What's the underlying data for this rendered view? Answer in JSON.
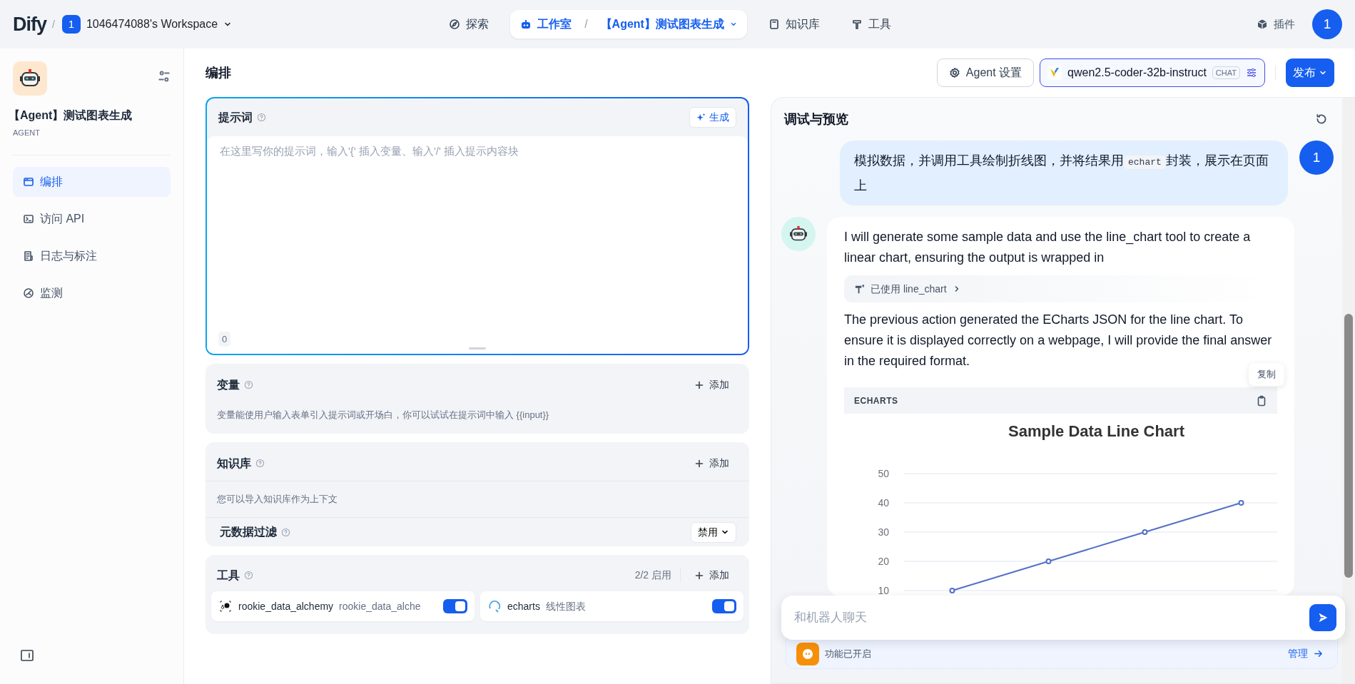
{
  "topbar": {
    "logo": "Dify",
    "separator": "/",
    "workspace": {
      "badge": "1",
      "name": "1046474088's Workspace"
    },
    "nav": [
      {
        "label": "探索",
        "kind": "explore",
        "selected": false
      },
      {
        "label": "工作室",
        "kind": "studio",
        "selected": true,
        "separator": "/",
        "app_name": "【Agent】测试图表生成"
      },
      {
        "label": "知识库",
        "kind": "knowledge",
        "selected": false
      },
      {
        "label": "工具",
        "kind": "tools",
        "selected": false
      }
    ],
    "plugins": "插件",
    "avatar": "1"
  },
  "sidebar": {
    "app_name": "【Agent】测试图表生成",
    "app_type": "AGENT",
    "items": [
      {
        "label": "编排",
        "kind": "window",
        "selected": true
      },
      {
        "label": "访问 API",
        "kind": "terminal",
        "selected": false
      },
      {
        "label": "日志与标注",
        "kind": "log",
        "selected": false
      },
      {
        "label": "监测",
        "kind": "gauge",
        "selected": false
      }
    ]
  },
  "page_title": "编排",
  "toolbar": {
    "agent_settings": "Agent 设置",
    "model": {
      "name": "qwen2.5-coder-32b-instruct",
      "mode": "CHAT"
    },
    "publish": "发布"
  },
  "prompt": {
    "title": "提示词",
    "generate": "生成",
    "placeholder": "在这里写你的提示词，输入'{' 插入变量、输入'/' 插入提示内容块",
    "count": "0"
  },
  "variables": {
    "title": "变量",
    "add": "添加",
    "description": "变量能使用户输入表单引入提示词或开场白，你可以试试在提示词中输入 {{input}}"
  },
  "knowledge": {
    "title": "知识库",
    "add": "添加",
    "description": "您可以导入知识库作为上下文",
    "metadata_filter": {
      "label": "元数据过滤",
      "value": "禁用"
    }
  },
  "tools": {
    "title": "工具",
    "status": "2/2 启用",
    "add": "添加",
    "items": [
      {
        "name": "rookie_data_alchemy",
        "label": "rookie_data_alche",
        "kind": "alchemy",
        "enabled": true
      },
      {
        "name": "echarts",
        "label": "线性图表",
        "kind": "echarts",
        "enabled": true
      }
    ]
  },
  "preview": {
    "title": "调试与预览",
    "user_message": {
      "avatar": "1",
      "parts": [
        {
          "kind": "text",
          "text": "模拟数据，并调用工具绘制折线图，并将结果用"
        },
        {
          "kind": "code",
          "text": "echart"
        },
        {
          "kind": "text",
          "text": "封装，展示在页面上"
        }
      ]
    },
    "bot_message": {
      "blocks": [
        {
          "kind": "text",
          "text": "I will generate some sample data and use the line_chart tool to create a linear chart, ensuring the output is wrapped in"
        },
        {
          "kind": "tool",
          "text": "已使用 line_chart"
        },
        {
          "kind": "text",
          "text": "The previous action generated the ECharts JSON for the line chart. To ensure it is displayed correctly on a webpage, I will provide the final answer in the required format."
        },
        {
          "kind": "code",
          "language": "ECHARTS",
          "copy": "复制",
          "chart_data": {
            "type": "line",
            "title": "Sample Data Line Chart",
            "series": [
              {
                "color": "#5470c6",
                "marker": "circle",
                "values": [
                  10,
                  20,
                  30,
                  40
                ]
              }
            ],
            "ylim": [
              10,
              50
            ],
            "yticks": [
              10,
              20,
              30,
              40,
              50
            ],
            "grid": true
          }
        }
      ]
    },
    "input_placeholder": "和机器人聊天",
    "features": {
      "label": "功能已开启",
      "manage": "管理"
    }
  }
}
